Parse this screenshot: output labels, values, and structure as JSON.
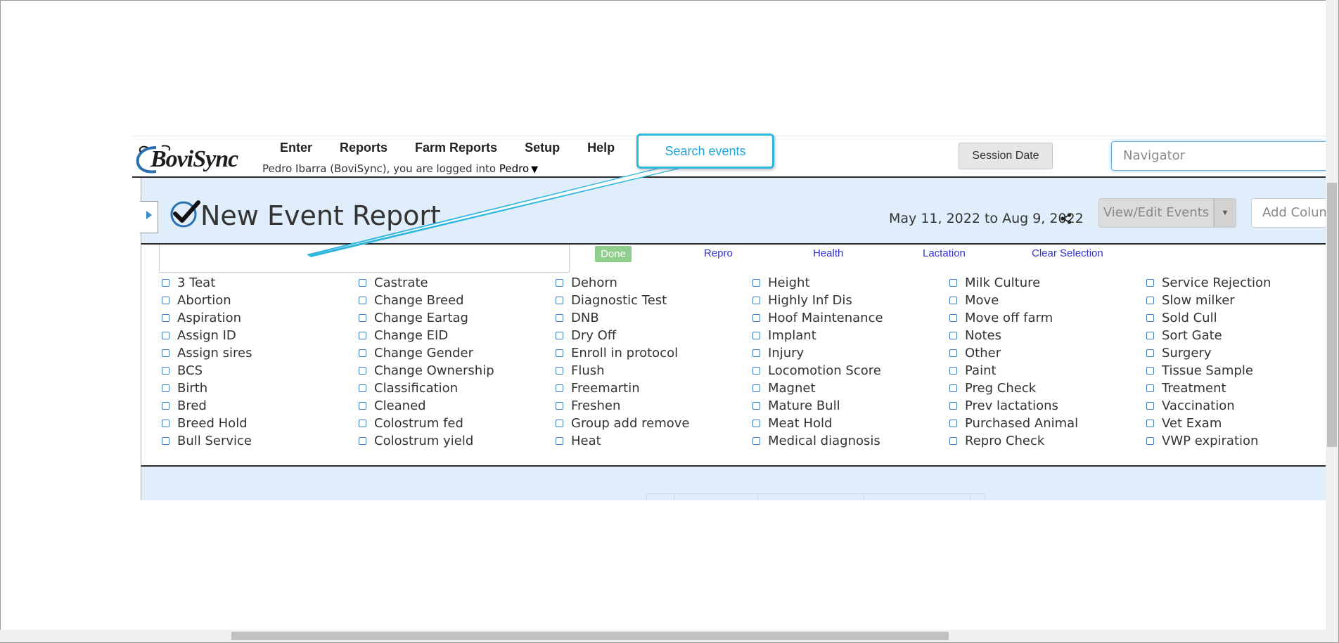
{
  "navbar": {
    "logo_text": "BoviSync",
    "menu": [
      "Enter",
      "Reports",
      "Farm Reports",
      "Setup",
      "Help"
    ],
    "login_text": "Pedro Ibarra (BoviSync), you are logged into",
    "farm_name": "Pedro",
    "farm_caret": "▼",
    "session_date_label": "Session Date",
    "navigator_placeholder": "Navigator"
  },
  "report": {
    "title": "New Event Report",
    "date_range": "May 11, 2022 to Aug 9, 2022",
    "view_edit_label": "View/Edit Events",
    "add_column_placeholder": "Add Column"
  },
  "picker": {
    "done_label": "Done",
    "quick_links": [
      "Repro",
      "Health",
      "Lactation",
      "Clear Selection"
    ],
    "columns": [
      [
        "3 Teat",
        "Abortion",
        "Aspiration",
        "Assign ID",
        "Assign sires",
        "BCS",
        "Birth",
        "Bred",
        "Breed Hold",
        "Bull Service"
      ],
      [
        "Castrate",
        "Change Breed",
        "Change Eartag",
        "Change EID",
        "Change Gender",
        "Change Ownership",
        "Classification",
        "Cleaned",
        "Colostrum fed",
        "Colostrum yield"
      ],
      [
        "Dehorn",
        "Diagnostic Test",
        "DNB",
        "Dry Off",
        "Enroll in protocol",
        "Flush",
        "Freemartin",
        "Freshen",
        "Group add remove",
        "Heat"
      ],
      [
        "Height",
        "Highly Inf Dis",
        "Hoof Maintenance",
        "Implant",
        "Injury",
        "Locomotion Score",
        "Magnet",
        "Mature Bull",
        "Meat Hold",
        "Medical diagnosis"
      ],
      [
        "Milk Culture",
        "Move",
        "Move off farm",
        "Notes",
        "Other",
        "Paint",
        "Preg Check",
        "Prev lactations",
        "Purchased Animal",
        "Repro Check"
      ],
      [
        "Service Rejection",
        "Slow milker",
        "Sold Cull",
        "Sort Gate",
        "Surgery",
        "Tissue Sample",
        "Treatment",
        "Vaccination",
        "Vet Exam",
        "VWP expiration"
      ]
    ]
  },
  "callout": {
    "text": "Search events"
  },
  "colors": {
    "accent": "#2fb6dd",
    "header_band": "#dfeefa",
    "done_green": "#8fce8c",
    "link_blue": "#3333cc"
  }
}
